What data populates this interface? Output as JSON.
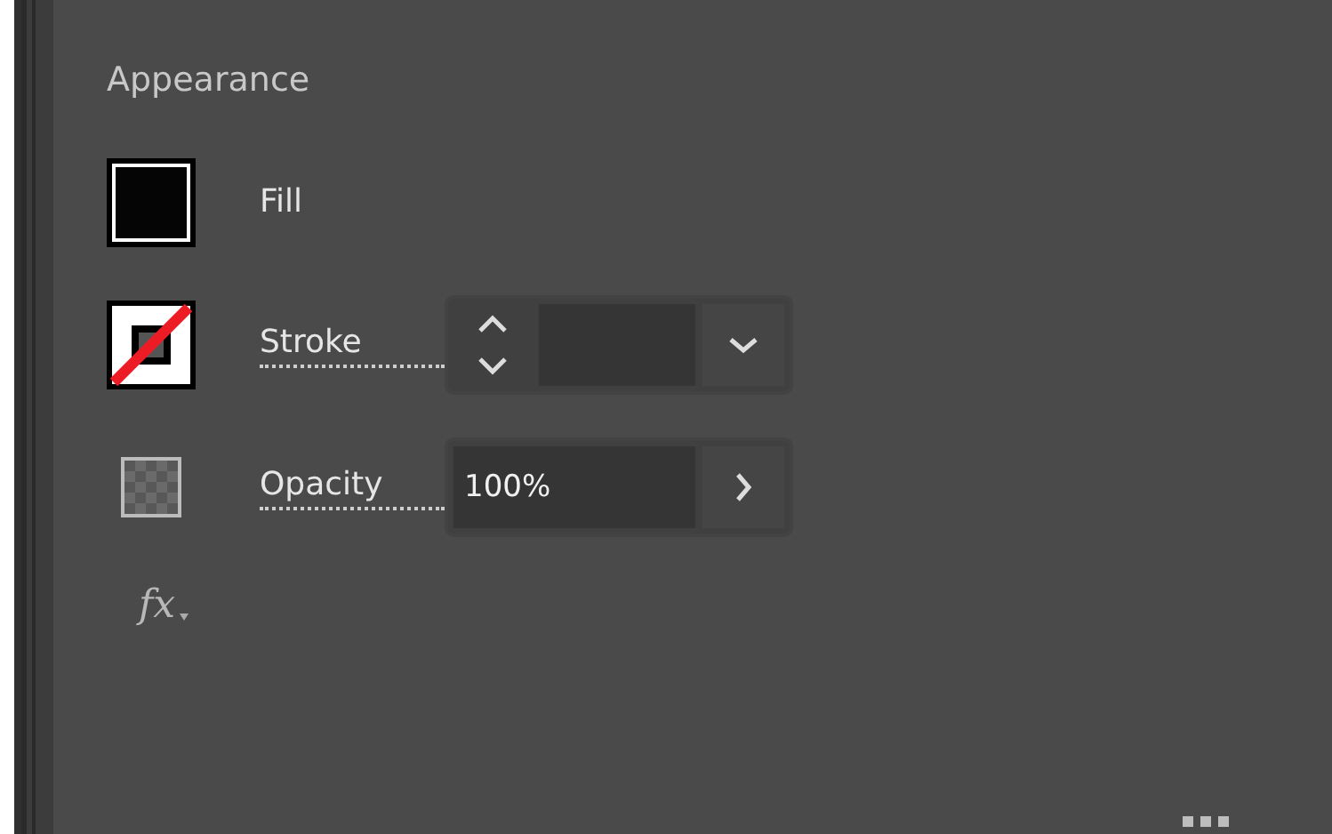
{
  "panel": {
    "title": "Appearance",
    "rows": [
      {
        "kind": "fill",
        "label": "Fill"
      },
      {
        "kind": "stroke",
        "label": "Stroke"
      },
      {
        "kind": "opacity",
        "label": "Opacity",
        "value": "100%"
      }
    ],
    "effects_button": "fx"
  }
}
